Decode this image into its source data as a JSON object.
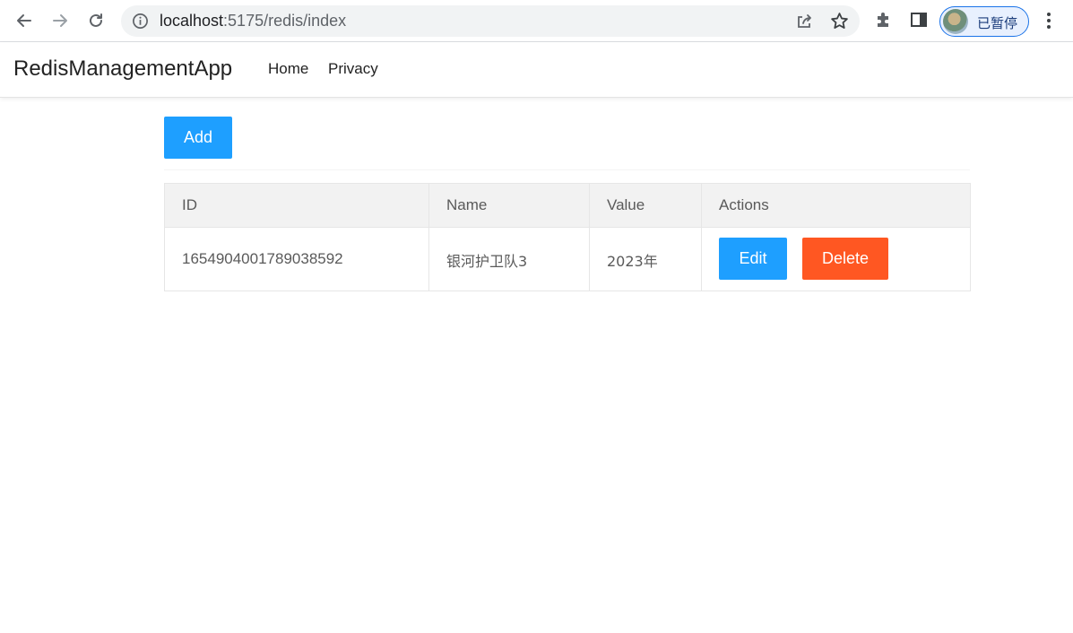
{
  "browser": {
    "url_host": "localhost",
    "url_path": ":5175/redis/index",
    "profile_label": "已暂停"
  },
  "app": {
    "brand": "RedisManagementApp",
    "nav": {
      "home": "Home",
      "privacy": "Privacy"
    }
  },
  "toolbar": {
    "add_label": "Add"
  },
  "table": {
    "headers": {
      "id": "ID",
      "name": "Name",
      "value": "Value",
      "actions": "Actions"
    },
    "rows": [
      {
        "id": "1654904001789038592",
        "name": "银河护卫队3",
        "value": "2023年",
        "edit_label": "Edit",
        "delete_label": "Delete"
      }
    ]
  },
  "colors": {
    "primary": "#1e9fff",
    "danger": "#ff5722"
  }
}
